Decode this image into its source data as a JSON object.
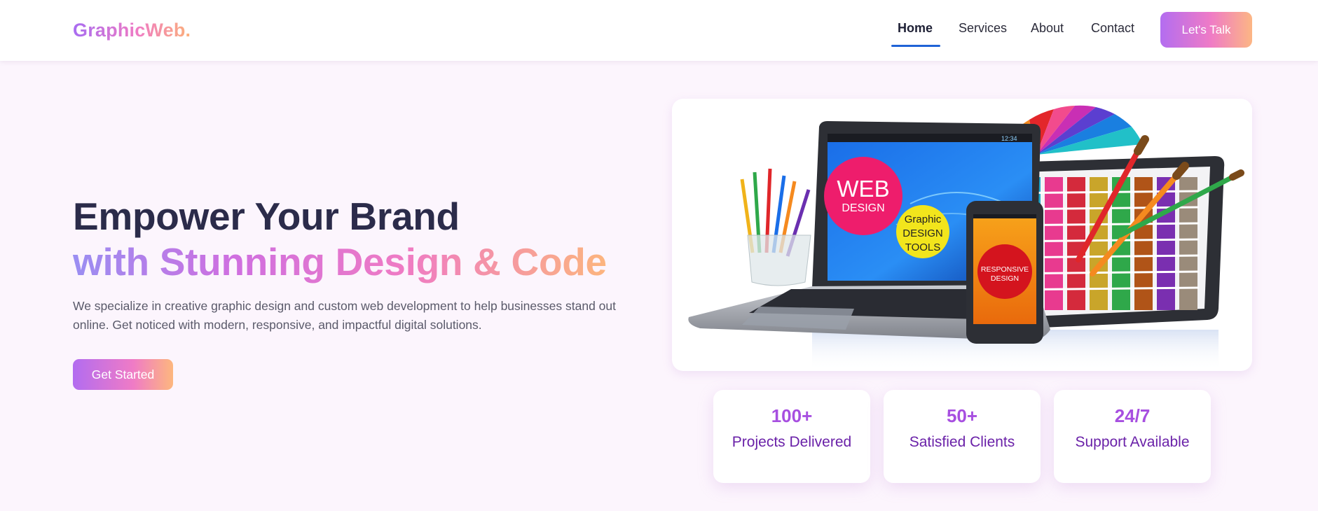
{
  "brand": {
    "logo": "GraphicWeb."
  },
  "nav": {
    "items": [
      {
        "label": "Home",
        "active": true
      },
      {
        "label": "Services",
        "active": false
      },
      {
        "label": "About",
        "active": false
      },
      {
        "label": "Contact",
        "active": false
      }
    ],
    "cta_label": "Let's Talk"
  },
  "hero": {
    "title_line1": "Empower Your Brand",
    "title_line2": "with Stunning Design & Code",
    "description": "We specialize in creative graphic design and custom web development to help businesses stand out online. Get noticed with modern, responsive, and impactful digital solutions.",
    "cta_label": "Get Started"
  },
  "hero_image": {
    "web_design_line1": "WEB",
    "web_design_line2": "DESIGN",
    "tools_line1": "Graphic",
    "tools_line2": "DESIGN",
    "tools_line3": "TOOLS",
    "responsive_line1": "RESPONSIVE",
    "responsive_line2": "DESIGN",
    "screen_time": "12:34"
  },
  "stats": [
    {
      "value": "100+",
      "label": "Projects Delivered"
    },
    {
      "value": "50+",
      "label": "Satisfied Clients"
    },
    {
      "value": "24/7",
      "label": "Support Available"
    }
  ],
  "colors": {
    "page_bg": "#fcf5fd",
    "gradient_start": "#a86cf1",
    "gradient_mid": "#ef7bc4",
    "gradient_end": "#fcb07a",
    "heading": "#2b2b4a",
    "stat_value": "#a74fe0",
    "stat_label": "#6a21a8",
    "nav_active_underline": "#1f63d6"
  }
}
